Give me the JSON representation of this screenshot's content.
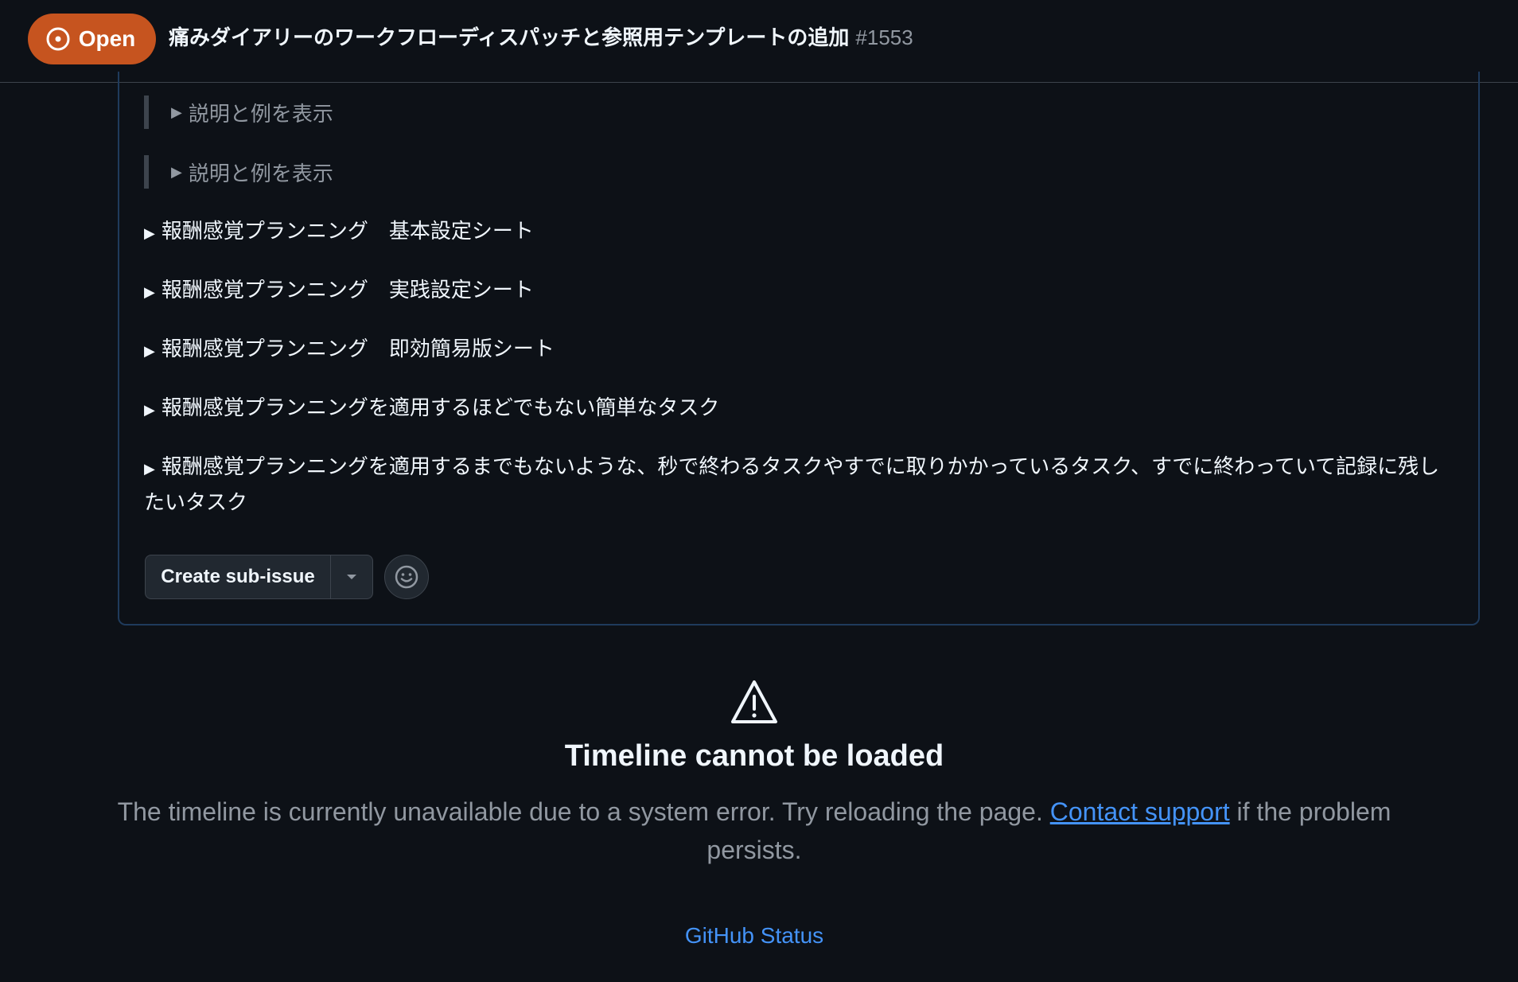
{
  "header": {
    "state_label": "Open",
    "title": "痛みダイアリーのワークフローディスパッチと参照用テンプレートの追加",
    "number": "#1553"
  },
  "comment": {
    "quotes": [
      {
        "label": "説明と例を表示"
      },
      {
        "label": "説明と例を表示"
      }
    ],
    "details": [
      {
        "label": "報酬感覚プランニング　基本設定シート"
      },
      {
        "label": "報酬感覚プランニング　実践設定シート"
      },
      {
        "label": "報酬感覚プランニング　即効簡易版シート"
      },
      {
        "label": "報酬感覚プランニングを適用するほどでもない簡単なタスク"
      },
      {
        "label": "報酬感覚プランニングを適用するまでもないような、秒で終わるタスクやすでに取りかかっているタスク、すでに終わっていて記録に残したいタスク"
      }
    ],
    "triangle": "▶",
    "create_sub_issue_label": "Create sub-issue"
  },
  "error": {
    "title": "Timeline cannot be loaded",
    "message_before": "The timeline is currently unavailable due to a system error. Try reloading the page. ",
    "contact_link": "Contact support",
    "message_after": " if the problem persists.",
    "status_link": "GitHub Status"
  },
  "colors": {
    "background": "#0d1117",
    "open_badge": "#c6541f",
    "link": "#4493f8",
    "muted_text": "#9198a1"
  },
  "icons": {
    "state": "issue-opened-icon",
    "dropdown": "triangle-down-icon",
    "reaction": "smiley-icon",
    "error": "alert-icon"
  }
}
